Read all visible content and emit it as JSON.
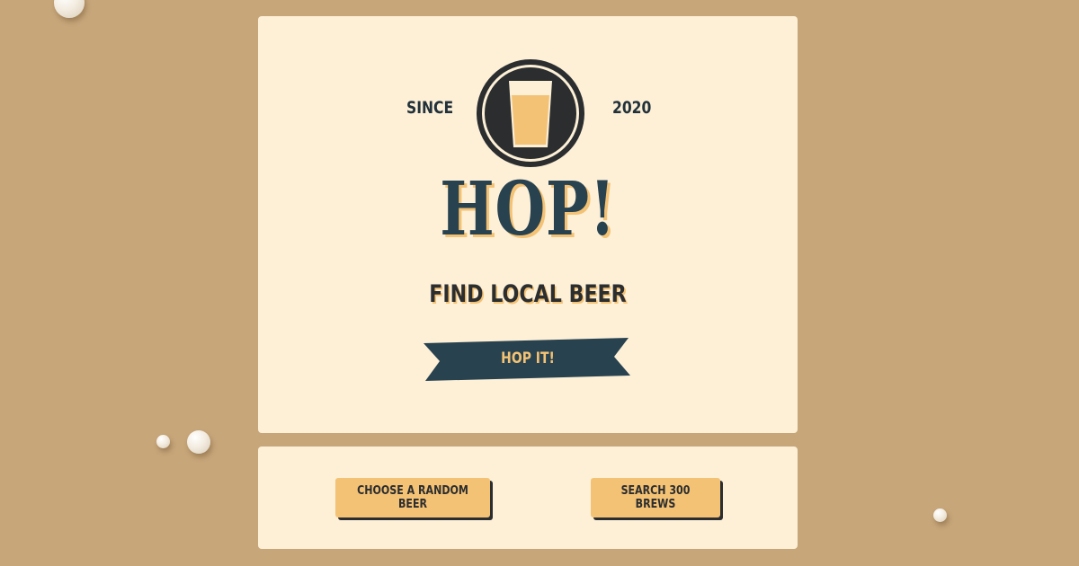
{
  "hero": {
    "since_label": "SINCE",
    "year": "2020",
    "logo_icon": "beer-glass-icon",
    "title": "HOP!",
    "subtitle": "FIND LOCAL BEER",
    "cta_label": "HOP IT!"
  },
  "actions": {
    "random_label": "CHOOSE A RANDOM BEER",
    "search_label": "SEARCH 300 BREWS"
  },
  "colors": {
    "background": "#c7a67a",
    "card": "#fdf0d7",
    "navy": "#28424f",
    "amber": "#f4c274",
    "dark": "#2b2d2f"
  }
}
